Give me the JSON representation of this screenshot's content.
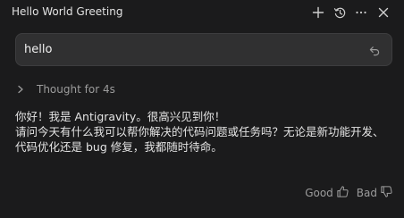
{
  "header": {
    "title": "Hello World Greeting",
    "actions": [
      "plus-icon",
      "history-icon",
      "more-icon",
      "close-icon"
    ]
  },
  "input": {
    "value": "hello",
    "icon": "undo-icon"
  },
  "thought": {
    "label": "Thought for 4s",
    "icon": "chevron-right-icon"
  },
  "response": {
    "line1": "你好！我是 Antigravity。很高兴见到你！",
    "line2": "请问今天有什么我可以帮你解决的代码问题或任务吗？无论是新功能开发、代码优化还是 bug 修复，我都随时待命。"
  },
  "feedback": {
    "good_label": "Good",
    "bad_label": "Bad",
    "good_icon": "thumbs-up-icon",
    "bad_icon": "thumbs-down-icon"
  },
  "colors": {
    "background": "#1b1b1c",
    "input_background": "#303031",
    "text": "#e4e4e4",
    "muted": "#9c9c9c"
  }
}
